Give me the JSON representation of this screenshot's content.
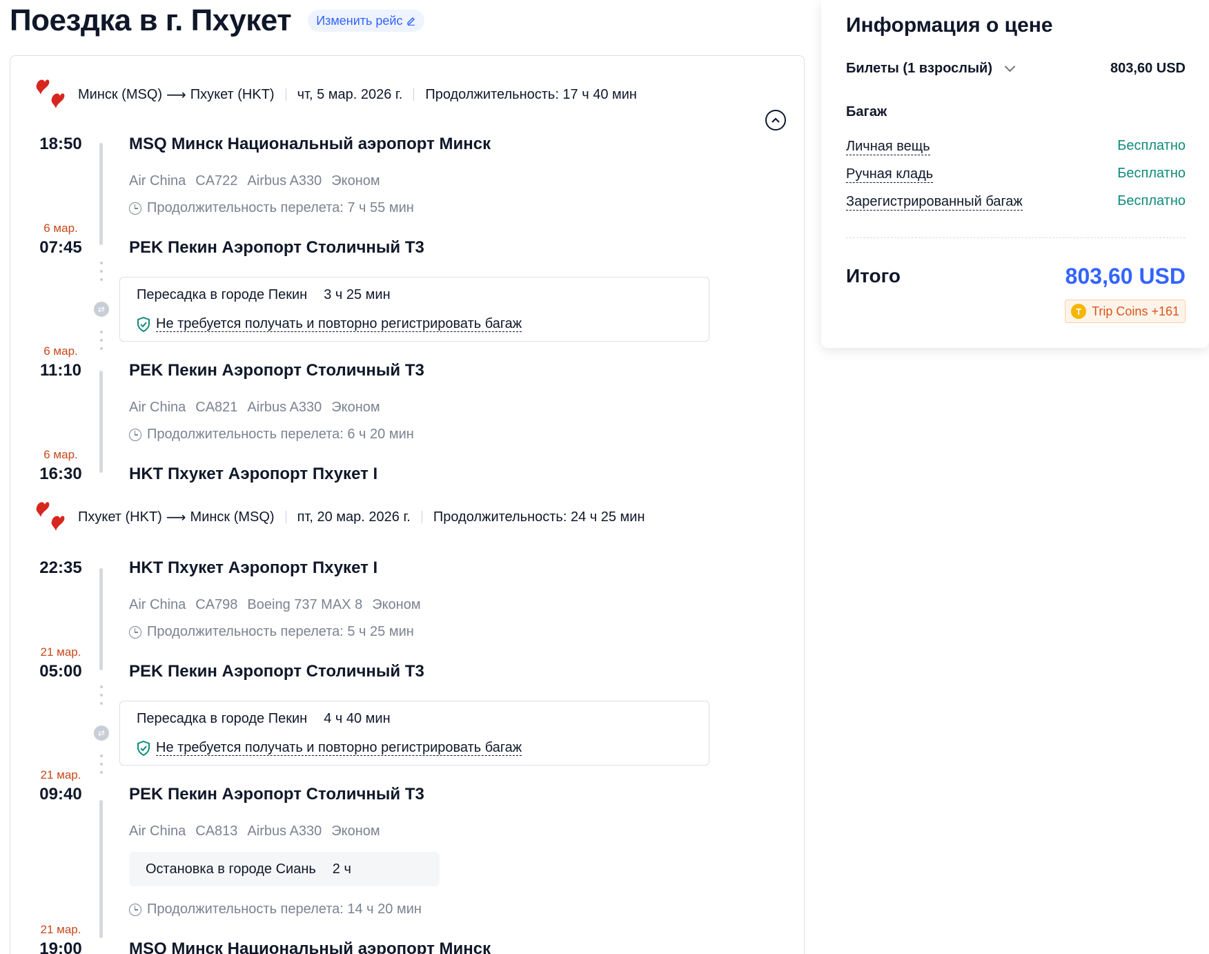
{
  "title": "Поездка в г. Пхукет",
  "change_flight_label": "Изменить рейс",
  "outbound": {
    "from": "Минск (MSQ)",
    "to": "Пхукет (HKT)",
    "date": "чт, 5 мар. 2026 г.",
    "total_duration": "Продолжительность: 17 ч 40 мин",
    "segments": [
      {
        "dep_time": "18:50",
        "dep_airport": "MSQ Минск Национальный аэропорт Минск",
        "airline": "Air China",
        "flight": "CA722",
        "aircraft": "Airbus A330",
        "cabin": "Эконом",
        "duration": "Продолжительность перелета: 7 ч 55 мин",
        "arr_date": "6 мар.",
        "arr_time": "07:45",
        "arr_airport": "PEK Пекин Аэропорт Столичный T3"
      },
      {
        "dep_date": "6 мар.",
        "dep_time": "11:10",
        "dep_airport": "PEK Пекин Аэропорт Столичный T3",
        "airline": "Air China",
        "flight": "CA821",
        "aircraft": "Airbus A330",
        "cabin": "Эконом",
        "duration": "Продолжительность перелета: 6 ч 20 мин",
        "arr_date": "6 мар.",
        "arr_time": "16:30",
        "arr_airport": "HKT Пхукет Аэропорт Пхукет I"
      }
    ],
    "layover": {
      "city": "Пересадка в городе Пекин",
      "time": "3 ч 25 мин",
      "note": "Не требуется получать и повторно регистрировать багаж"
    }
  },
  "return": {
    "from": "Пхукет (HKT)",
    "to": "Минск (MSQ)",
    "date": "пт, 20 мар. 2026 г.",
    "total_duration": "Продолжительность: 24 ч 25 мин",
    "segments": [
      {
        "dep_time": "22:35",
        "dep_airport": "HKT Пхукет Аэропорт Пхукет I",
        "airline": "Air China",
        "flight": "CA798",
        "aircraft": "Boeing 737 MAX 8",
        "cabin": "Эконом",
        "duration": "Продолжительность перелета: 5 ч 25 мин",
        "arr_date": "21 мар.",
        "arr_time": "05:00",
        "arr_airport": "PEK Пекин Аэропорт Столичный T3"
      },
      {
        "dep_date": "21 мар.",
        "dep_time": "09:40",
        "dep_airport": "PEK Пекин Аэропорт Столичный T3",
        "airline": "Air China",
        "flight": "CA813",
        "aircraft": "Airbus A330",
        "cabin": "Эконом",
        "stop": "Остановка в городе Сиань",
        "stop_time": "2 ч",
        "duration": "Продолжительность перелета: 14 ч 20 мин",
        "arr_date": "21 мар.",
        "arr_time": "19:00",
        "arr_airport": "MSQ Минск Национальный аэропорт Минск"
      }
    ],
    "layover": {
      "city": "Пересадка в городе Пекин",
      "time": "4 ч 40 мин",
      "note": "Не требуется получать и повторно регистрировать багаж"
    }
  },
  "price": {
    "title": "Информация о цене",
    "tickets_label": "Билеты (1 взрослый)",
    "tickets_value": "803,60 USD",
    "baggage_title": "Багаж",
    "baggage": [
      {
        "label": "Личная вещь",
        "value": "Бесплатно"
      },
      {
        "label": "Ручная кладь",
        "value": "Бесплатно"
      },
      {
        "label": "Зарегистрированный багаж",
        "value": "Бесплатно"
      }
    ],
    "total_label": "Итого",
    "total_value": "803,60 USD",
    "coins_label": "Trip Coins +161",
    "coin_glyph": "T"
  },
  "colors": {
    "accent": "#3264ff",
    "date_highlight": "#c8481a",
    "free": "#0f8a7a",
    "airline_red": "#d7261e"
  }
}
